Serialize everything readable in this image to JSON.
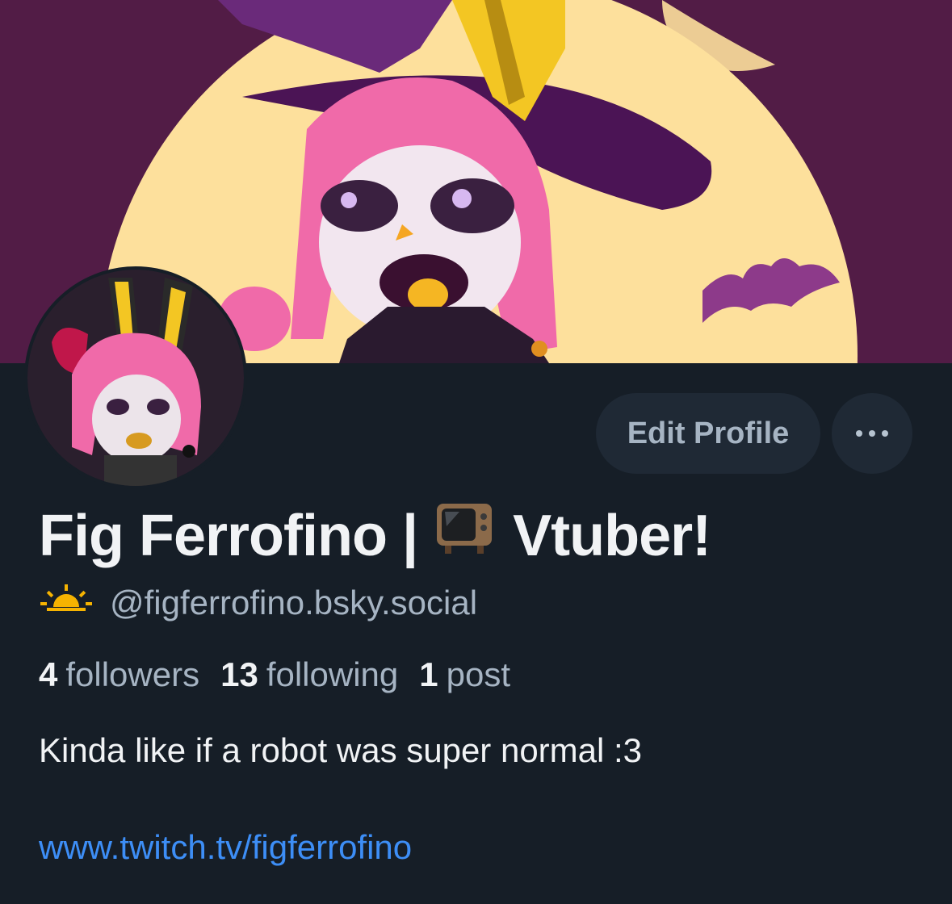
{
  "profile": {
    "display_name_left": "Fig Ferrofino |",
    "display_name_right": "Vtuber!",
    "handle": "@figferrofino.bsky.social",
    "handle_icon": "sunrise-icon",
    "name_icon": "television-icon",
    "bio": "Kinda like if a robot was super normal :3",
    "link": "www.twitch.tv/figferrofino"
  },
  "stats": {
    "followers_count": "4",
    "followers_label": "followers",
    "following_count": "13",
    "following_label": "following",
    "posts_count": "1",
    "posts_label": "post"
  },
  "actions": {
    "edit_profile_label": "Edit Profile",
    "more_icon": "ellipsis-icon"
  },
  "colors": {
    "background": "#161e27",
    "banner_purple": "#521c46",
    "banner_moon": "#fde09c",
    "link": "#3d8ef6",
    "muted_text": "#a6b4c3"
  }
}
